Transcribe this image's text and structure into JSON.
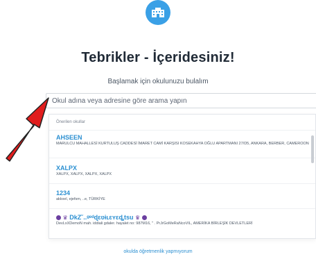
{
  "header": {
    "title": "Tebrikler - İçeridesiniz!",
    "subtitle": "Başlamak için okulunuzu bulalım",
    "badge_icon": "school-building-icon",
    "badge_color": "#3aa0e6"
  },
  "search": {
    "placeholder": "Okul adına veya adresine göre arama yapın",
    "value": ""
  },
  "dropdown": {
    "header": "Önerilen okullar",
    "items": [
      {
        "name": "AHSEEN",
        "address": "MARULCU MAHALLESİ KURTULUŞ CADDESİ İMARET CAMİ KARŞISI KOSEKAHYA OĞLU APARTMANI 27/D5, ANKARA, BERBER, CAMEROON"
      },
      {
        "name": "XALPX",
        "address": "XALPX, XALPX, XALPX, XALPX"
      },
      {
        "name": "1234",
        "address": "akkxel, ejefsm, ..e, TÜRKİYE"
      },
      {
        "name": "DkZ˘..ᵍᵉᵈɖɛʋɨʟɛʏɛȡtsu",
        "address": "DevLxXDemoN mah. iddiali gdaler. hayalet no: 987M16, \" . PrJrGoMeRaNcoVIL, AMERİKA BİRLEŞİK DEVLETLERİ"
      }
    ]
  },
  "footer": {
    "link": "okulda öğretmenlik yapmıyorum"
  },
  "colors": {
    "accent": "#2b8fd1",
    "arrow": "#e11d1d"
  }
}
